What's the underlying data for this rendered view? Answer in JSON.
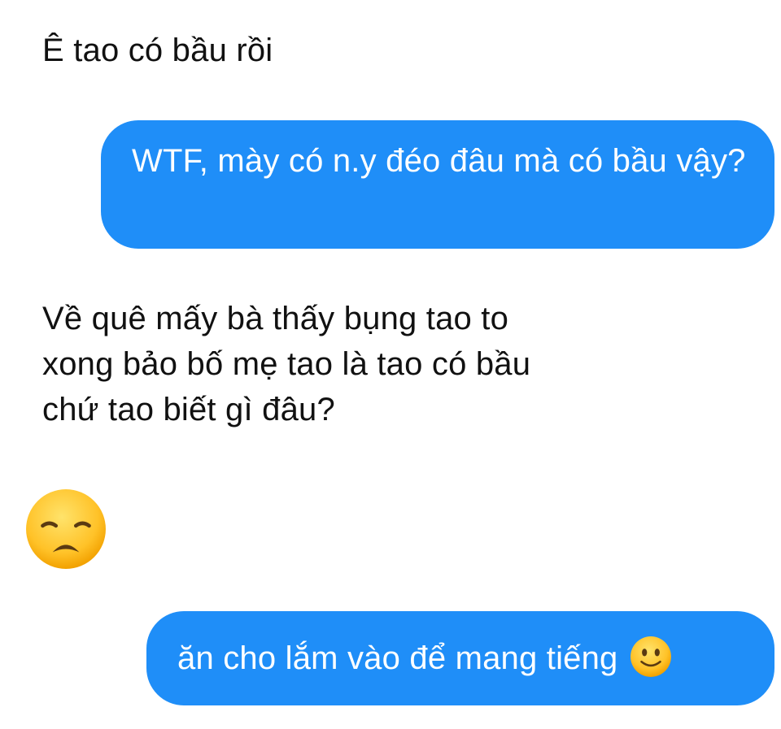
{
  "conversation": {
    "messages": [
      {
        "direction": "incoming",
        "text": "Ê tao có bầu rồi"
      },
      {
        "direction": "outgoing",
        "text": "WTF, mày có n.y đéo đâu mà có bầu vậy?"
      },
      {
        "direction": "incoming",
        "text": "Về quê mấy bà thấy bụng tao to\nxong bảo bố mẹ tao là tao có bầu\nchứ tao biết gì đâu?"
      },
      {
        "direction": "incoming",
        "emoji": "disappointed-face"
      },
      {
        "direction": "outgoing",
        "text": "ăn cho lắm vào để mang tiếng",
        "trailing_emoji": "slightly-smiling-face"
      }
    ]
  },
  "colors": {
    "outgoing_bubble": "#1f8ef8",
    "outgoing_text": "#ffffff",
    "incoming_text": "#111111",
    "background": "#ffffff",
    "emoji_face": "#ffc83a"
  }
}
